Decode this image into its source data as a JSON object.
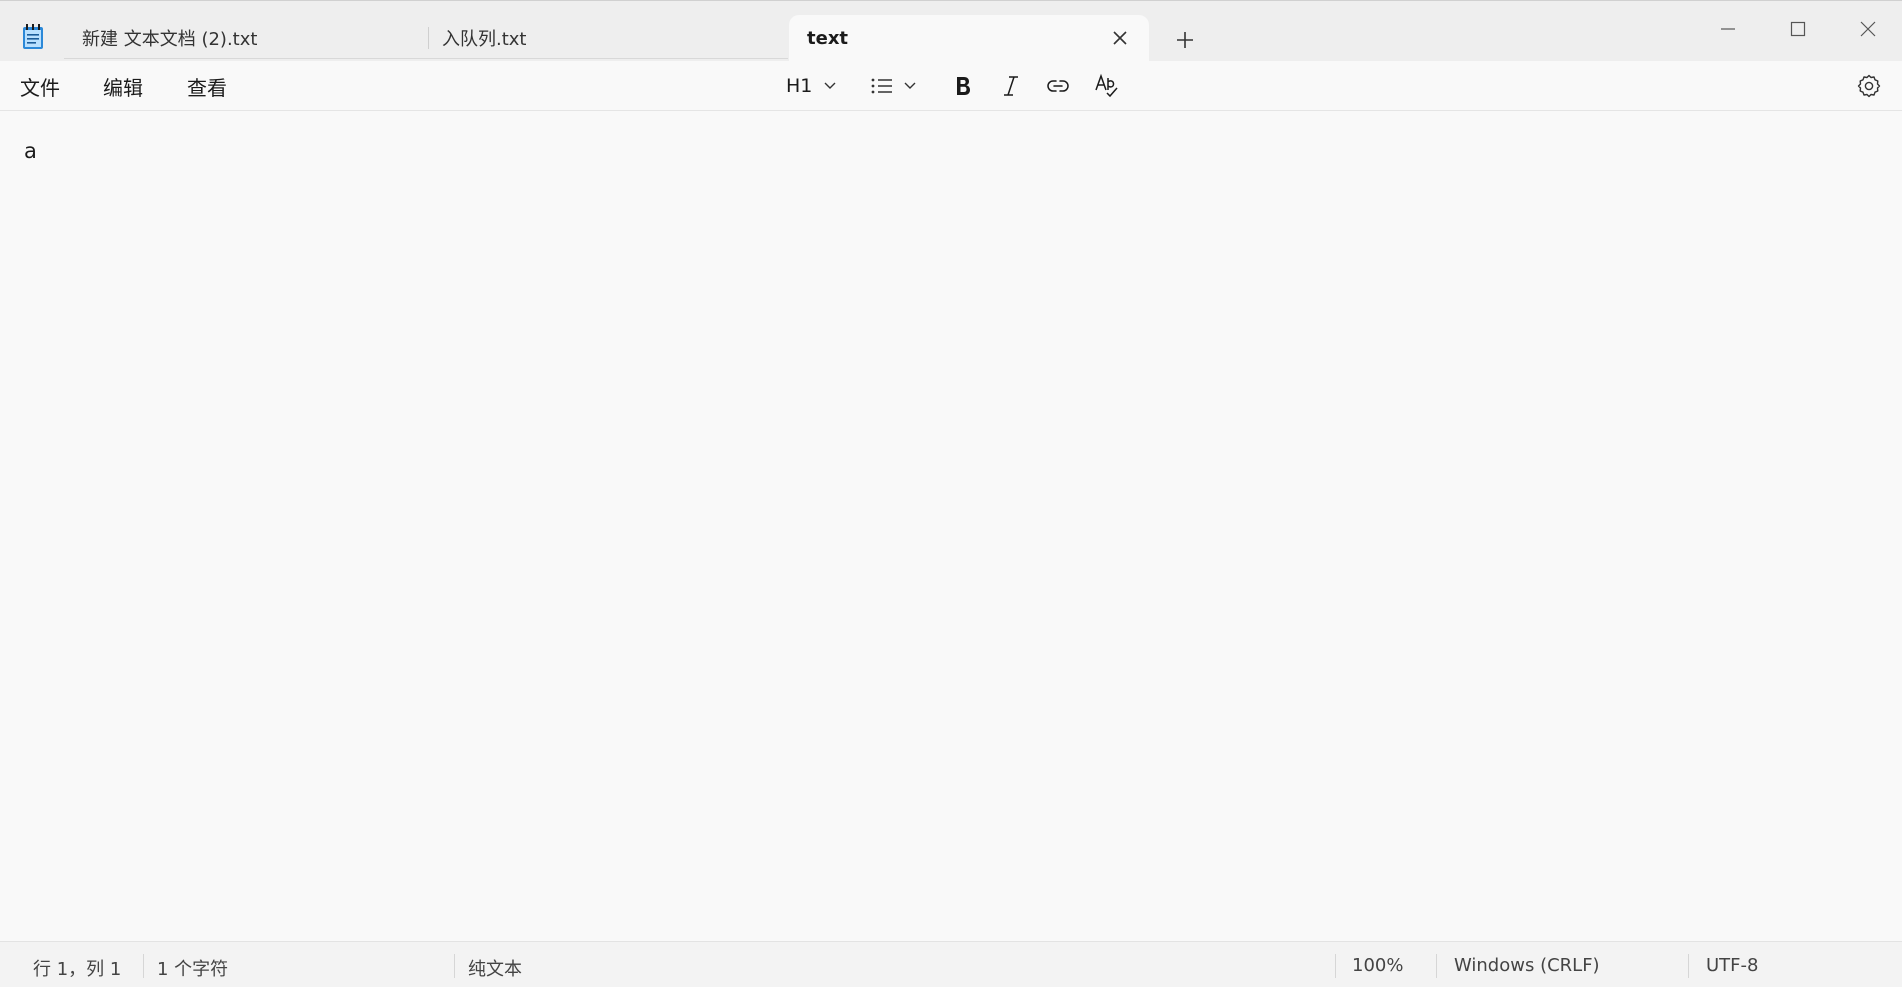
{
  "tabs": [
    {
      "label": "新建 文本文档 (2).txt",
      "active": false
    },
    {
      "label": "入队列.txt",
      "active": false
    },
    {
      "label": "text",
      "active": true
    }
  ],
  "menu": {
    "file": "文件",
    "edit": "编辑",
    "view": "查看"
  },
  "toolbar": {
    "heading_label": "H1"
  },
  "editor": {
    "content": "a"
  },
  "status": {
    "position": "行 1，列 1",
    "char_count": "1 个字符",
    "format": "纯文本",
    "zoom": "100%",
    "line_ending": "Windows (CRLF)",
    "encoding": "UTF-8"
  },
  "colors": {
    "app_icon": "#2b88d8",
    "background": "#f9f9f9"
  }
}
